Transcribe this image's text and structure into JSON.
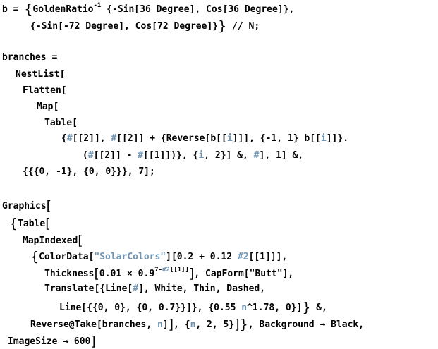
{
  "notebook": {
    "line1": {
      "pre": "b = ",
      "open_brace": "{",
      "fn": "GoldenRatio",
      "sup": "-1",
      "post": " {-Sin[36 Degree], Cos[36 Degree]},"
    },
    "line2": {
      "text": "{-Sin[-72 Degree], Cos[72 Degree]}",
      "close_brace": "}",
      "post": " // N;"
    },
    "branches": {
      "l1": "branches =",
      "l2": "NestList[",
      "l3": "Flatten[",
      "l4": "Map[",
      "l5": "Table[",
      "l6": {
        "a": "{",
        "b": "#",
        "c": "[[2]], ",
        "d": "#",
        "e": "[[2]] + {Reverse[b[[",
        "f": "i",
        "g": "]]], {-1, 1} b[[",
        "h": "i",
        "i": "]]}."
      },
      "l7": {
        "a": "(",
        "b": "#",
        "c": "[[2]] - ",
        "d": "#",
        "e": "[[1]])}, {",
        "f": "i",
        "g": ", 2}] &, ",
        "h": "#",
        "i": "], 1] &,"
      },
      "l8": "{{{0, -1}, {0, 0}}}, 7];"
    },
    "graphics": {
      "g1_text": "Graphics",
      "g1_bracket": "[",
      "g2_brace": "{",
      "g2_text": "Table",
      "g2_bracket": "[",
      "g3_text": "MapIndexed",
      "g3_bracket": "[",
      "g4": {
        "brace": "{",
        "a": "ColorData[",
        "str": "\"SolarColors\"",
        "b": "][0.2 + 0.12 ",
        "hash": "#2",
        "c": "[[1]]",
        "d": "],"
      },
      "g5": {
        "a": "Thickness",
        "lb": "[",
        "b": "0.01 × 0.9",
        "sup_a": "7-",
        "sup_b": "#2",
        "sup_c": "[[1]]",
        "rb": "]",
        "c": ", CapForm[\"Butt\"],"
      },
      "g6": {
        "a": "Translate[{Line[",
        "hash": "#",
        "b": "], White, Thin, Dashed,"
      },
      "g7": {
        "a": "Line[{{0, 0}, {0, 0.7}}]}, {0.55 ",
        "n": "n",
        "b": "^1.78, 0}]",
        "rb": "}",
        "c": " &,"
      },
      "g8": {
        "a": "Reverse@Take[branches, ",
        "n1": "n",
        "b": "]",
        "rb1": "]",
        "c": ", {",
        "n2": "n",
        "d": ", 2, 5}",
        "rb2": "]",
        "rb3": "}",
        "e": ", Background → Black,"
      },
      "g9": {
        "a": "ImageSize → 600",
        "rb": "]"
      }
    }
  }
}
